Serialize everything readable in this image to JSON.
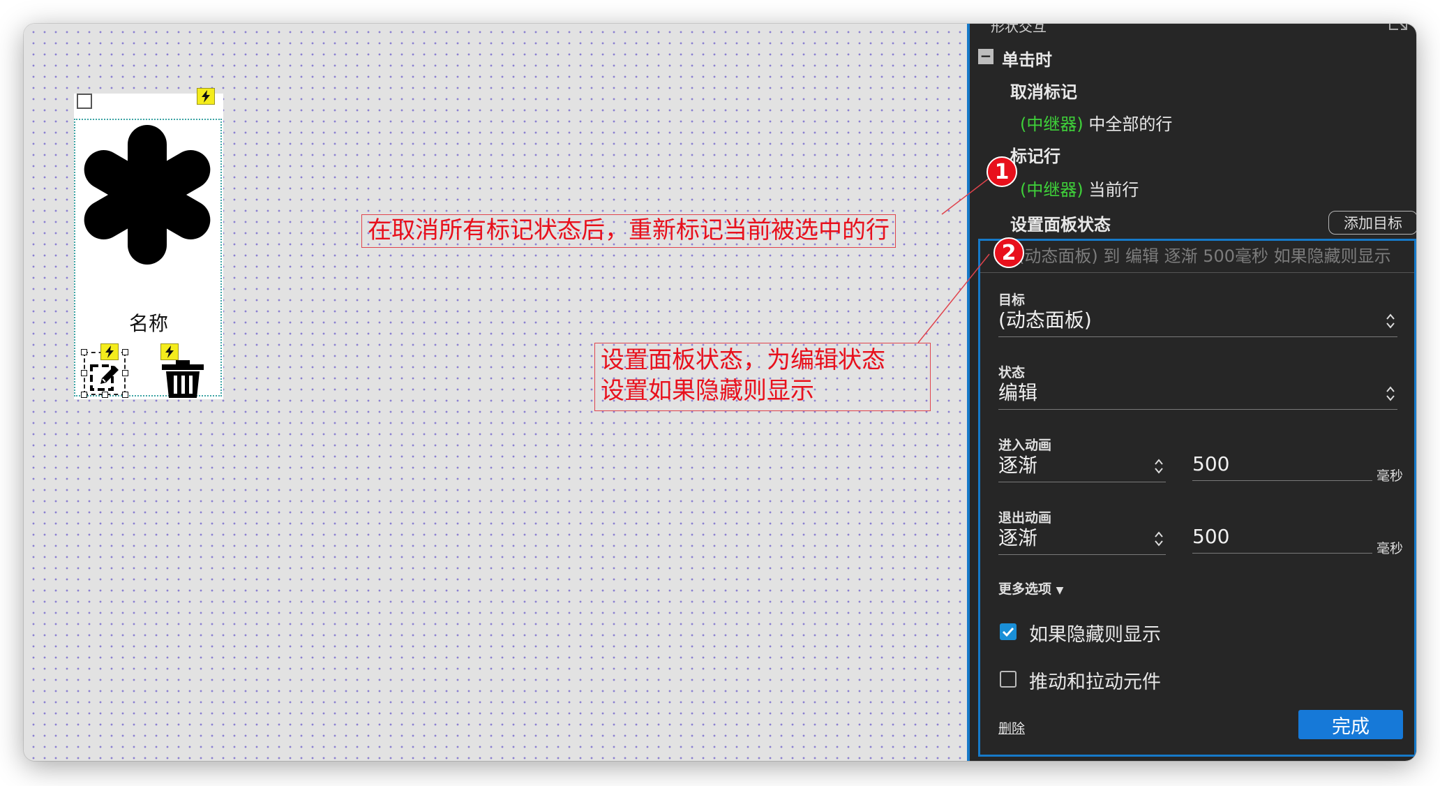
{
  "panel": {
    "section_header": "形状交互",
    "event": "单击时",
    "actions": [
      {
        "label": "取消标记",
        "tag": "(中继器)",
        "detail": "中全部的行"
      },
      {
        "label": "标记行",
        "tag": "(中继器)",
        "detail": "当前行"
      },
      {
        "label": "设置面板状态"
      }
    ],
    "add_target_label": "添加目标",
    "editor": {
      "summary": "(动态面板) 到 编辑 逐渐 500毫秒 如果隐藏则显示",
      "target_label": "目标",
      "target_value": "(动态面板)",
      "state_label": "状态",
      "state_value": "编辑",
      "enter_anim_label": "进入动画",
      "enter_anim_value": "逐渐",
      "enter_duration": "500",
      "exit_anim_label": "退出动画",
      "exit_anim_value": "逐渐",
      "exit_duration": "500",
      "ms_unit": "毫秒",
      "more_options_label": "更多选项",
      "options": [
        {
          "label": "如果隐藏则显示",
          "checked": true
        },
        {
          "label": "推动和拉动元件",
          "checked": false
        }
      ],
      "delete_label": "删除",
      "done_label": "完成"
    }
  },
  "canvas": {
    "widget_name_label": "名称"
  },
  "annotations": [
    {
      "badge": "1",
      "text": "在取消所有标记状态后，重新标记当前被选中的行"
    },
    {
      "badge": "2",
      "text_line1": "设置面板状态，为编辑状态",
      "text_line2": "设置如果隐藏则显示"
    }
  ],
  "colors": {
    "accent_blue": "#1679c8",
    "annotation_red": "#e8101c",
    "repeater_green": "#3fd13a",
    "panel_bg": "#262626"
  }
}
